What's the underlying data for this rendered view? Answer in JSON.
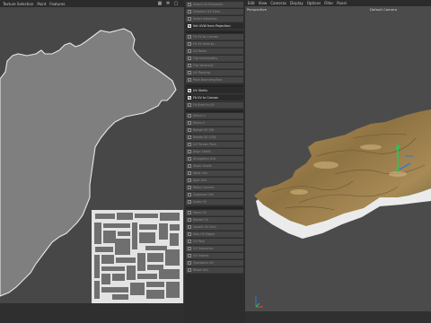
{
  "uv_editor": {
    "menu": [
      "Texture Selection",
      "Point",
      "Features"
    ],
    "icons": [
      "grid-icon",
      "settings-icon",
      "close-icon"
    ]
  },
  "uv_commands": {
    "items": [
      {
        "label": "Select UV Elements",
        "active": false
      },
      {
        "label": "Deselect UV Elem...",
        "active": false
      },
      {
        "label": "Invert Selection",
        "active": false
      },
      {
        "label": "Set UVW from Projection",
        "active": true
      },
      {
        "label": "Fit UV to Canvas",
        "active": false
      },
      {
        "label": "Fit UV Area to...",
        "active": false
      },
      {
        "label": "UV Relax",
        "active": false
      },
      {
        "label": "Flip Horizontally",
        "active": false
      },
      {
        "label": "Flip Vertically",
        "active": false
      },
      {
        "label": "UV Packing",
        "active": false
      },
      {
        "label": "Pack Bounding Box",
        "active": false
      },
      {
        "label": "UV Shells",
        "active": true
      },
      {
        "label": "Fit UV to Canvas",
        "active": true
      },
      {
        "label": "Fit Shell to UV",
        "active": false
      },
      {
        "label": "Mirror U",
        "active": false
      },
      {
        "label": "Mirror V",
        "active": false
      },
      {
        "label": "Rotate 90 CW",
        "active": false
      },
      {
        "label": "Rotate 90 CCW",
        "active": false
      },
      {
        "label": "UV Terrain Pack",
        "active": false
      },
      {
        "label": "Align Shells",
        "active": false
      },
      {
        "label": "Straighten UVs",
        "active": false
      },
      {
        "label": "Stack Shells",
        "active": false
      },
      {
        "label": "Weld UVs",
        "active": false
      },
      {
        "label": "Split UVs",
        "active": false
      },
      {
        "label": "Relax Corners",
        "active": false
      },
      {
        "label": "Optimize UVs",
        "active": false
      },
      {
        "label": "Scale UV",
        "active": false
      },
      {
        "label": "Move UV",
        "active": false
      },
      {
        "label": "Rotate UV",
        "active": false
      },
      {
        "label": "Layout UV Grid",
        "active": false
      },
      {
        "label": "Sew UV Edges",
        "active": false
      },
      {
        "label": "UV Peel",
        "active": false
      },
      {
        "label": "UV Sequence",
        "active": false
      },
      {
        "label": "UV Seams",
        "active": false
      },
      {
        "label": "Transform UV",
        "active": false
      },
      {
        "label": "Reset UVs",
        "active": false
      }
    ]
  },
  "viewport": {
    "menu": [
      "Edit",
      "View",
      "Cameras",
      "Display",
      "Options",
      "Filter",
      "Panel"
    ],
    "view_name": "Perspective",
    "camera_name": "Default Camera"
  },
  "colors": {
    "accent_active": "#e4e4e4",
    "terrain_top": "#a2814f",
    "terrain_side": "#e8e8e8",
    "gizmo_green": "#2fbf5b",
    "gizmo_blue": "#2c7bd6",
    "axis_red": "#e04545"
  }
}
